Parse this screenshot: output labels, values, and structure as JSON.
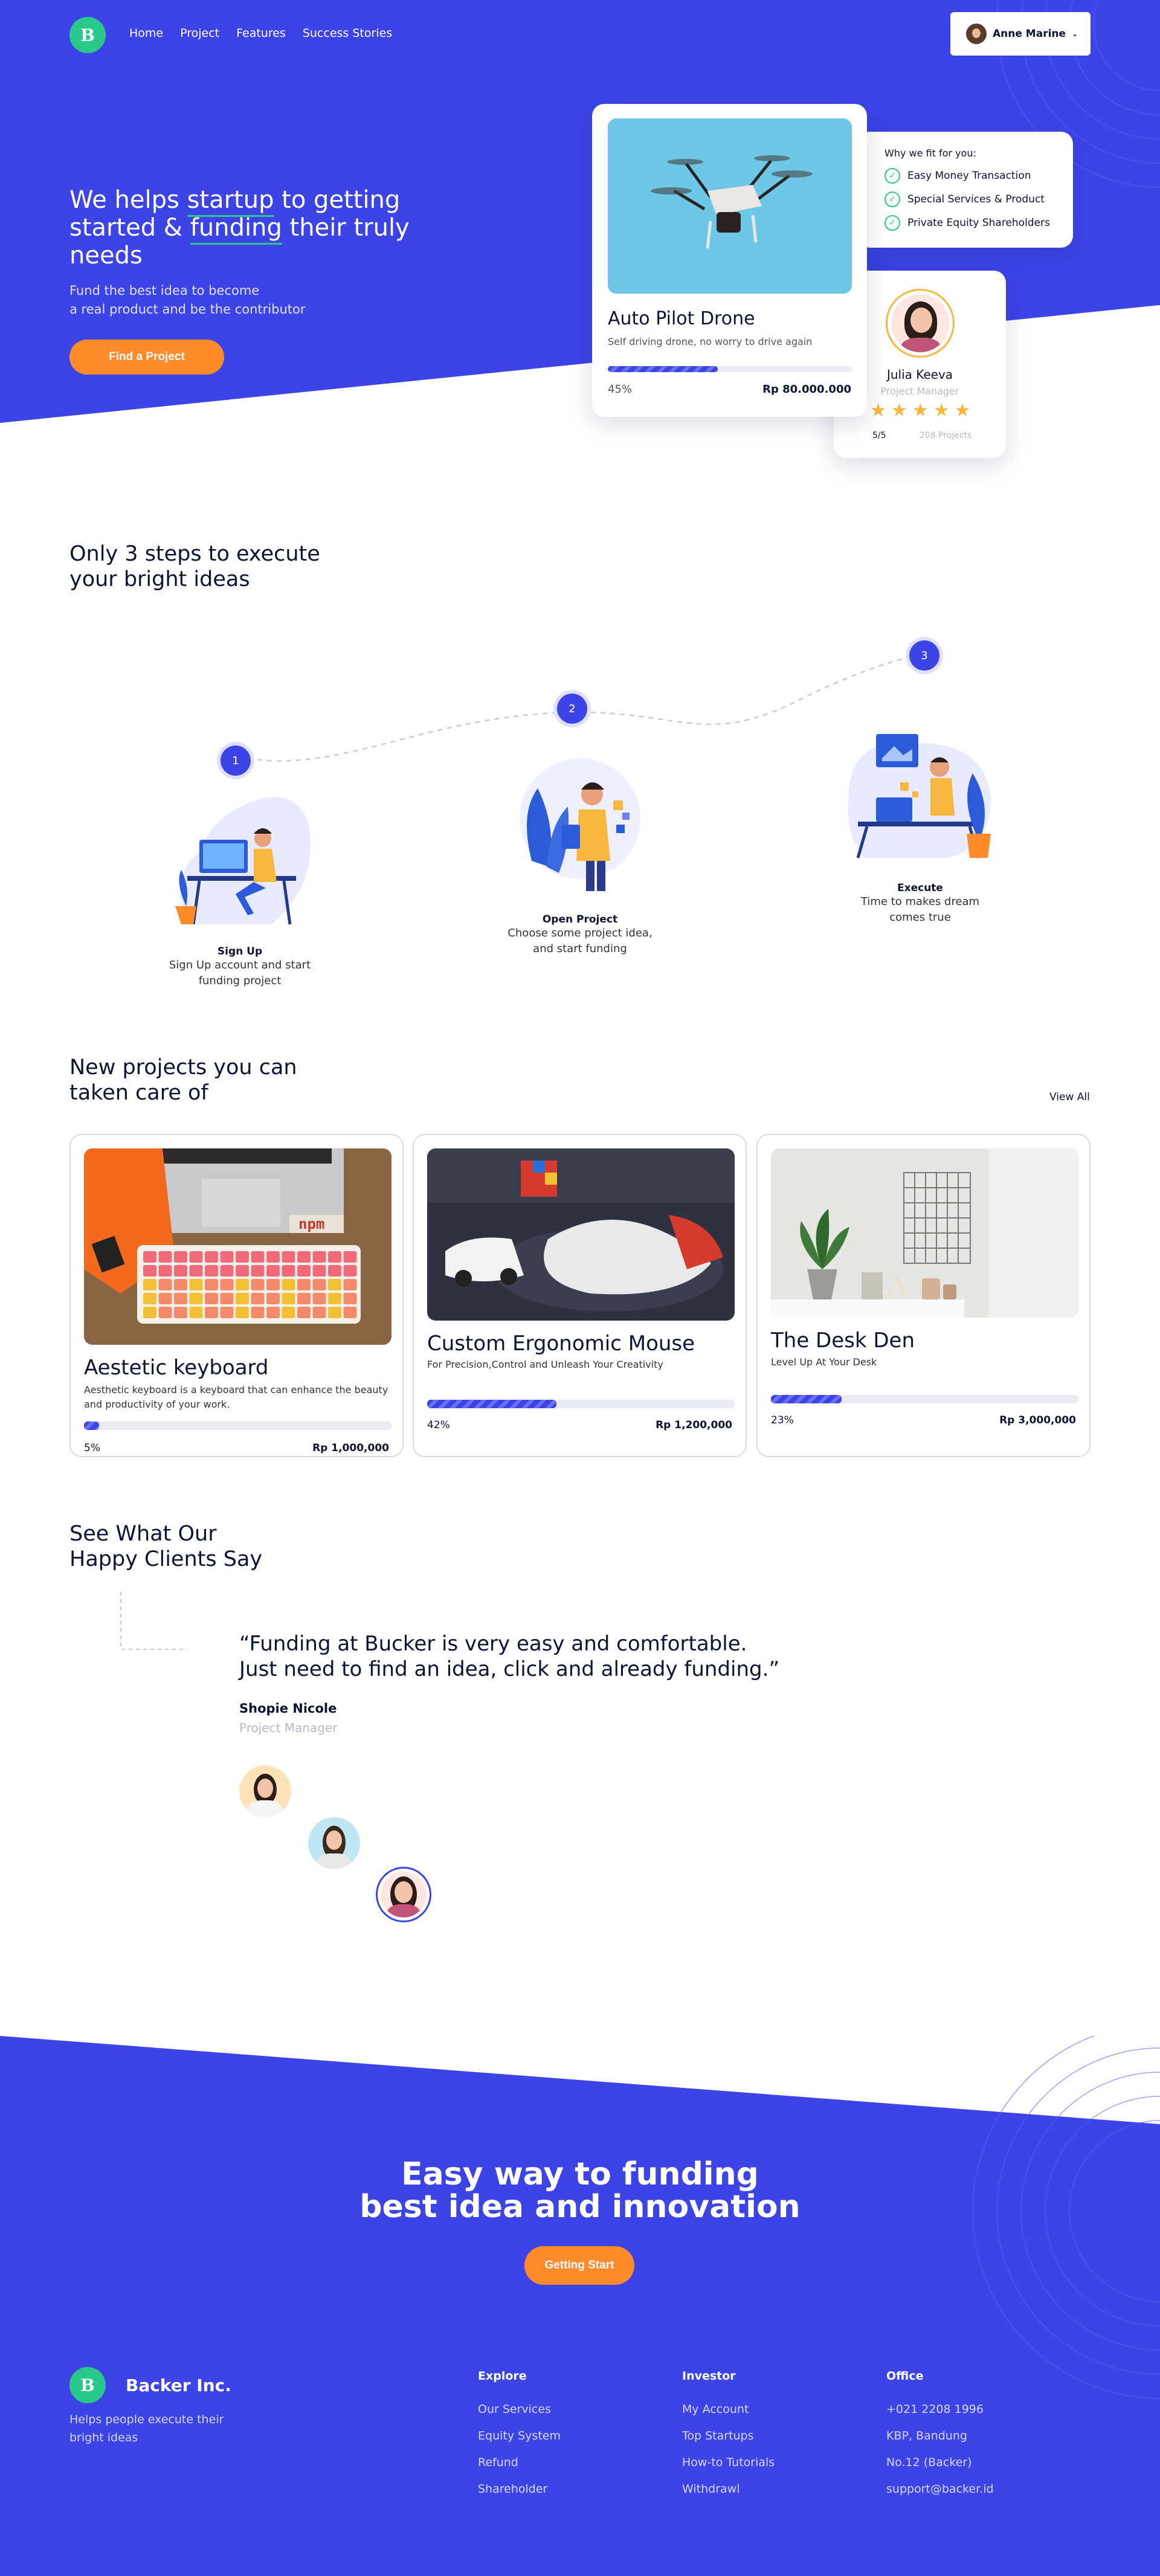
{
  "nav": {
    "logo_letter": "B",
    "links": [
      "Home",
      "Project",
      "Features",
      "Success Stories"
    ],
    "user_name": "Anne Marine"
  },
  "hero": {
    "title_pre": "We helps ",
    "title_u1": "startup",
    "title_mid": " to getting started & ",
    "title_u2": "funding",
    "title_post": " their truly needs",
    "subtitle_line1": "Fund the best idea to become",
    "subtitle_line2": "a real product and be the contributor",
    "cta": "Find a Project"
  },
  "featured": {
    "title": "Auto Pilot Drone",
    "desc": "Self driving drone, no worry to drive again",
    "progress": 0.45,
    "percent": "45%",
    "amount": "Rp 80.000.000"
  },
  "why": {
    "heading": "Why we fit for you:",
    "items": [
      "Easy Money Transaction",
      "Special Services & Product",
      "Private Equity Shareholders"
    ]
  },
  "manager": {
    "name": "Julia Keeva",
    "role": "Project Manager",
    "rating": "5/5",
    "projects": "208 Projects"
  },
  "steps": {
    "heading_line1": "Only 3 steps to execute",
    "heading_line2": "your bright ideas",
    "items": [
      {
        "num": "1",
        "title": "Sign Up",
        "desc1": "Sign Up account and start",
        "desc2": "funding project"
      },
      {
        "num": "2",
        "title": "Open Project",
        "desc1": "Choose some project idea,",
        "desc2": "and start funding"
      },
      {
        "num": "3",
        "title": "Execute",
        "desc1": "Time to makes dream",
        "desc2": "comes true"
      }
    ]
  },
  "projects": {
    "heading_line1": "New projects you can",
    "heading_line2": "taken care of",
    "view_all": "View All",
    "items": [
      {
        "title": "Aestetic keyboard",
        "desc": "Aesthetic keyboard is a keyboard that can enhance the beauty and productivity of your work.",
        "progress": 0.05,
        "percent": "5%",
        "amount": "Rp 1,000,000"
      },
      {
        "title": "Custom Ergonomic Mouse",
        "desc": "For Precision,Control and Unleash Your Creativity",
        "progress": 0.42,
        "percent": "42%",
        "amount": "Rp 1,200,000"
      },
      {
        "title": "The Desk Den",
        "desc": "Level Up At Your Desk",
        "progress": 0.23,
        "percent": "23%",
        "amount": "Rp 3,000,000"
      }
    ]
  },
  "testimonials": {
    "heading_line1": "See What Our",
    "heading_line2": "Happy Clients Say",
    "quote_line1": "“Funding at Bucker is very easy and comfortable.",
    "quote_line2": "Just need to find an idea, click and already funding.”",
    "name": "Shopie Nicole",
    "role": "Project Manager"
  },
  "cta": {
    "line1": "Easy way to funding",
    "line2": "best idea and innovation",
    "button": "Getting Start"
  },
  "footer": {
    "brand": "Backer Inc.",
    "tagline1": "Helps people execute their",
    "tagline2": "bright ideas",
    "cols": [
      {
        "heading": "Explore",
        "links": [
          "Our Services",
          "Equity System",
          "Refund",
          "Shareholder"
        ]
      },
      {
        "heading": "Investor",
        "links": [
          "My Account",
          "Top Startups",
          "How-to Tutorials",
          "Withdrawl"
        ]
      },
      {
        "heading": "Office",
        "links": [
          "+021 2208 1996",
          "KBP, Bandung",
          "No.12 (Backer)",
          "support@backer.id"
        ]
      }
    ]
  },
  "colors": {
    "primary": "#3d44e6",
    "accent": "#ff8a2a",
    "green": "#28c98a"
  }
}
